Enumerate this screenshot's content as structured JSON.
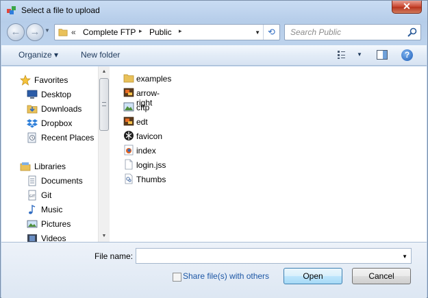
{
  "window": {
    "title": "Select a file to upload",
    "close_label": "✕"
  },
  "navigation": {
    "back_arrow": "←",
    "forward_arrow": "→",
    "address": {
      "overflow": "«",
      "segments": [
        "Complete FTP",
        "Public"
      ],
      "separator": "▸"
    },
    "search_placeholder": "Search Public"
  },
  "toolbar": {
    "organize_label": "Organize ▾",
    "new_folder_label": "New folder",
    "help_label": "?"
  },
  "sidebar": {
    "items": [
      {
        "label": "Favorites",
        "icon": "star-icon",
        "group": true
      },
      {
        "label": "Desktop",
        "icon": "desktop-icon"
      },
      {
        "label": "Downloads",
        "icon": "downloads-icon"
      },
      {
        "label": "Dropbox",
        "icon": "dropbox-icon"
      },
      {
        "label": "Recent Places",
        "icon": "recent-places-icon"
      },
      {
        "label": "Libraries",
        "icon": "libraries-icon",
        "group": true
      },
      {
        "label": "Documents",
        "icon": "documents-icon"
      },
      {
        "label": "Git",
        "icon": "git-icon"
      },
      {
        "label": "Music",
        "icon": "music-icon"
      },
      {
        "label": "Pictures",
        "icon": "pictures-icon"
      },
      {
        "label": "Videos",
        "icon": "videos-icon"
      }
    ]
  },
  "files": [
    {
      "name": "examples",
      "icon": "folder-icon"
    },
    {
      "name": "arrow-right",
      "icon": "image-file-icon"
    },
    {
      "name": "cftp",
      "icon": "picture-file-icon"
    },
    {
      "name": "edt",
      "icon": "image-file-icon"
    },
    {
      "name": "favicon",
      "icon": "favicon-file-icon"
    },
    {
      "name": "index",
      "icon": "firefox-file-icon"
    },
    {
      "name": "login.jss",
      "icon": "blank-file-icon"
    },
    {
      "name": "Thumbs",
      "icon": "thumbs-db-icon"
    }
  ],
  "footer": {
    "file_name_label": "File name:",
    "file_name_value": "",
    "share_label": "Share file(s) with others",
    "open_label": "Open",
    "cancel_label": "Cancel"
  },
  "colors": {
    "accent": "#1c56a5",
    "folder": "#e9c15a",
    "close_button": "#c8452e"
  }
}
